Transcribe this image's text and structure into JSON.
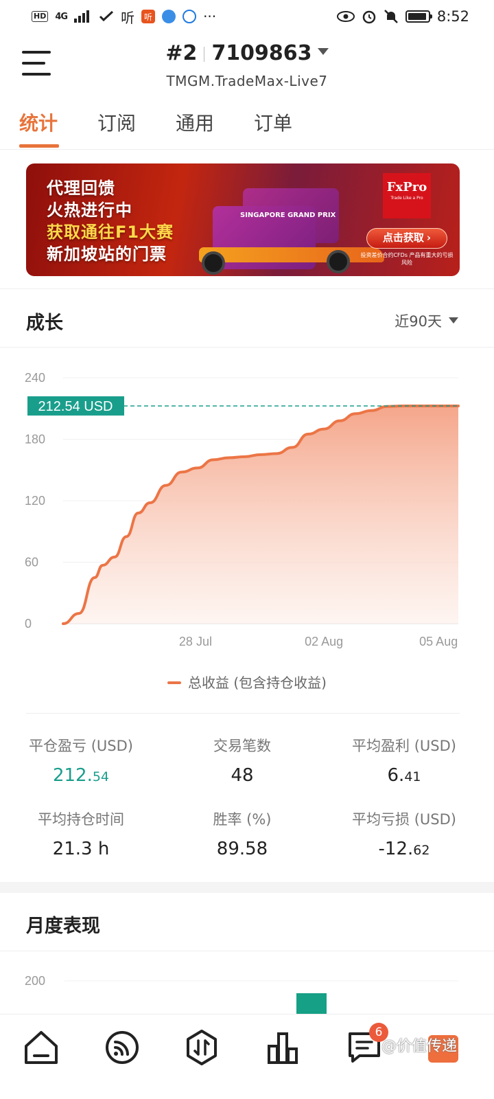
{
  "status_bar": {
    "hd_badge": "HD",
    "network": "4G",
    "app_listen": "听",
    "more": "···",
    "time": "8:52"
  },
  "header": {
    "account_index": "#2",
    "account_number": "7109863",
    "server": "TMGM.TradeMax-Live7"
  },
  "tabs": [
    {
      "label": "统计",
      "active": true
    },
    {
      "label": "订阅",
      "active": false
    },
    {
      "label": "通用",
      "active": false
    },
    {
      "label": "订单",
      "active": false
    }
  ],
  "banner": {
    "lines": [
      "代理回馈",
      "火热进行中",
      "获取通往F1大赛",
      "新加坡站的门票"
    ],
    "ticket_text": "SINGAPORE GRAND PRIX",
    "brand": "FxPro",
    "brand_tagline": "Trade Like a Pro",
    "cta": "点击获取",
    "risk": "投资差价合约CFDs 产品有重大的亏损风险",
    "colors": {
      "accent": "#c3260f",
      "highlight": "#ffd84a"
    }
  },
  "growth": {
    "title": "成长",
    "period": "近90天"
  },
  "chart_data": {
    "type": "area",
    "y_ticks": [
      "240",
      "180",
      "120",
      "60",
      "0"
    ],
    "x_ticks": [
      "28 Jul",
      "02 Aug",
      "05 Aug"
    ],
    "ylim": [
      0,
      240
    ],
    "current_value_label": "212.54 USD",
    "current_value": 212.54,
    "series": [
      {
        "name": "总收益 (包含持仓收益)",
        "color": "#ec7546",
        "x_index": [
          0,
          0.04,
          0.08,
          0.1,
          0.13,
          0.16,
          0.19,
          0.22,
          0.26,
          0.3,
          0.34,
          0.38,
          0.42,
          0.46,
          0.5,
          0.54,
          0.58,
          0.62,
          0.66,
          0.7,
          0.74,
          0.78,
          0.82,
          0.86,
          0.9,
          0.94,
          0.97,
          1.0
        ],
        "values": [
          0,
          10,
          45,
          57,
          65,
          85,
          108,
          118,
          135,
          148,
          152,
          160,
          162,
          163,
          165,
          166,
          172,
          185,
          190,
          198,
          205,
          208,
          212,
          212.54,
          212.54,
          212.54,
          212.54,
          212.54
        ]
      }
    ],
    "grid": true,
    "legend_position": "bottom",
    "fill_color": "#f6b39a",
    "reference_line_color": "#1a9e8c"
  },
  "stats": [
    {
      "label": "平仓盈亏 (USD)",
      "int": "212.",
      "dec": "54",
      "green": true
    },
    {
      "label": "交易笔数",
      "int": "48",
      "dec": "",
      "green": false
    },
    {
      "label": "平均盈利 (USD)",
      "int": "6.",
      "dec": "41",
      "green": false
    },
    {
      "label": "平均持仓时间",
      "int": "21.3 h",
      "dec": "",
      "green": false
    },
    {
      "label": "胜率 (%)",
      "int": "89.58",
      "dec": "",
      "green": false
    },
    {
      "label": "平均亏损 (USD)",
      "int": "-12.",
      "dec": "62",
      "green": false
    }
  ],
  "monthly": {
    "title": "月度表现",
    "y_tick": "200",
    "bar_color": "#16a085"
  },
  "bottom_nav": {
    "icons": [
      "home-icon",
      "feed-icon",
      "trade-icon",
      "chart-icon",
      "message-icon"
    ],
    "message_badge": "6",
    "watermark": "@价值传递"
  }
}
